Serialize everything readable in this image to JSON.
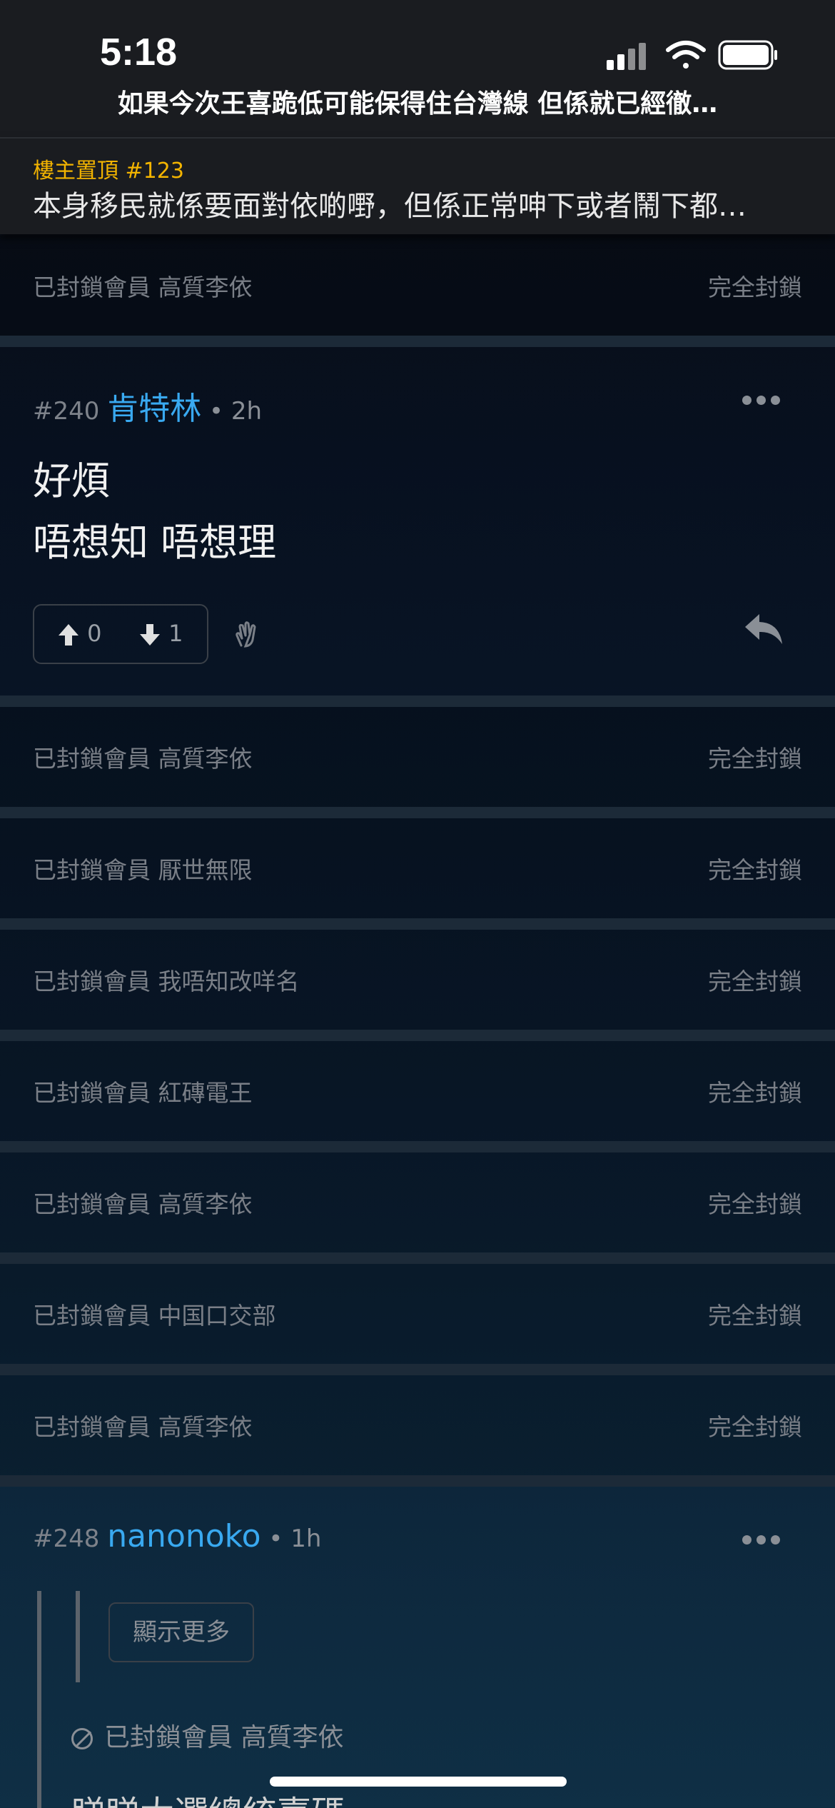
{
  "status_bar": {
    "time": "5:18"
  },
  "thread": {
    "title": "如果今次王喜跪低可能保得住台灣線 但係就已經徹…"
  },
  "pinned": {
    "label": "樓主置頂 #123",
    "text": "本身移民就係要面對依啲嘢，但係正常呻下或者鬧下都…"
  },
  "blocked_label_prefix": "已封鎖會員",
  "blocked_action": "完全封鎖",
  "blocked_rows_top": [
    {
      "name": "已封鎖會員 高質李依",
      "action": "完全封鎖"
    }
  ],
  "post_240": {
    "number": "#240",
    "username": "肯特林",
    "separator": "•",
    "time": "2h",
    "lines": [
      "好煩",
      "唔想知 唔想理"
    ],
    "upvotes": "0",
    "downvotes": "1"
  },
  "blocked_rows": [
    {
      "name": "已封鎖會員 高質李依",
      "action": "完全封鎖"
    },
    {
      "name": "已封鎖會員 厭世無限",
      "action": "完全封鎖"
    },
    {
      "name": "已封鎖會員 我唔知改咩名",
      "action": "完全封鎖"
    },
    {
      "name": "已封鎖會員 紅磚電王",
      "action": "完全封鎖"
    },
    {
      "name": "已封鎖會員 高質李依",
      "action": "完全封鎖"
    },
    {
      "name": "已封鎖會員 中国口交部",
      "action": "完全封鎖"
    },
    {
      "name": "已封鎖會員 高質李依",
      "action": "完全封鎖"
    }
  ],
  "post_248": {
    "number": "#248",
    "username": "nanonoko",
    "separator": "•",
    "time": "1h",
    "show_more": "顯示更多",
    "quoted_blocked": "已封鎖會員 高質李依",
    "cut_text": "睇睇大選總統嘉碼"
  },
  "colors": {
    "username": "#39a9f0",
    "pinned_label": "#f3b400",
    "muted": "#7a7f87"
  }
}
